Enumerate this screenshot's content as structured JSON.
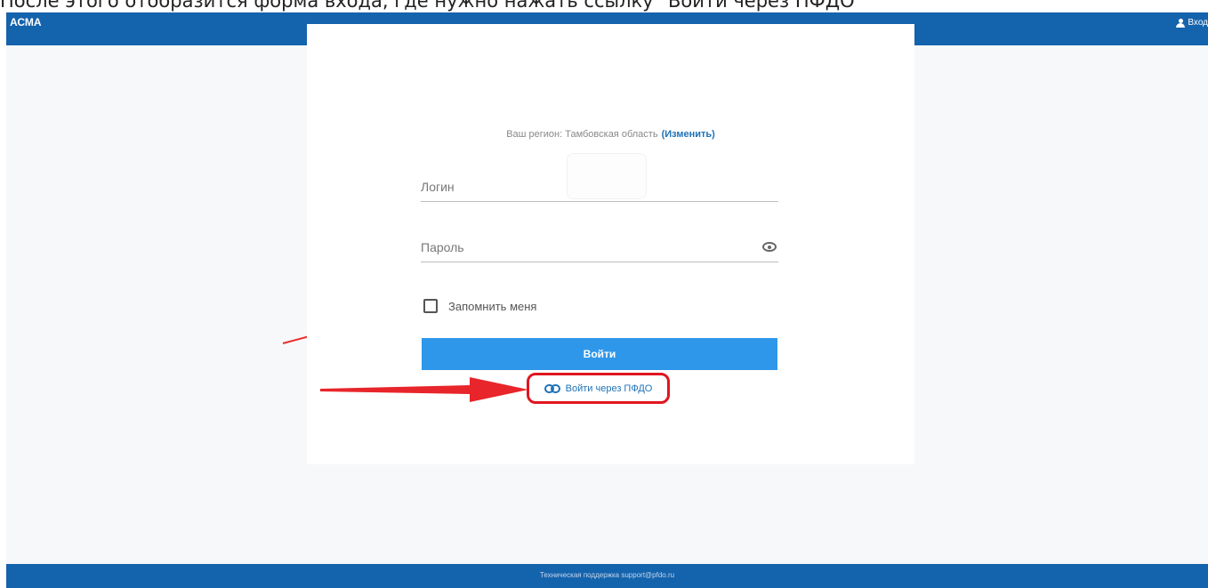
{
  "caption": "После этого отобразится форма входа, где нужно нажать ссылку \"Войти через ПФДО\"",
  "header": {
    "brand": "АСМА",
    "login_label": "Вход"
  },
  "region": {
    "prefix": "Ваш регион: Тамбовская область",
    "change_label": "(Изменить)"
  },
  "form": {
    "login_placeholder": "Логин",
    "password_placeholder": "Пароль",
    "remember_label": "Запомнить меня",
    "submit_label": "Войти",
    "pfdo_link_label": "Войти через ПФДО"
  },
  "footer": {
    "text": "Техническая поддержка support@pfdo.ru"
  },
  "colors": {
    "header": "#1463ad",
    "primary_button": "#2f97ea",
    "link": "#1f73b7",
    "highlight": "#e0161f"
  },
  "icons": [
    "user-icon",
    "eye-icon",
    "link-icon",
    "red-arrow"
  ]
}
